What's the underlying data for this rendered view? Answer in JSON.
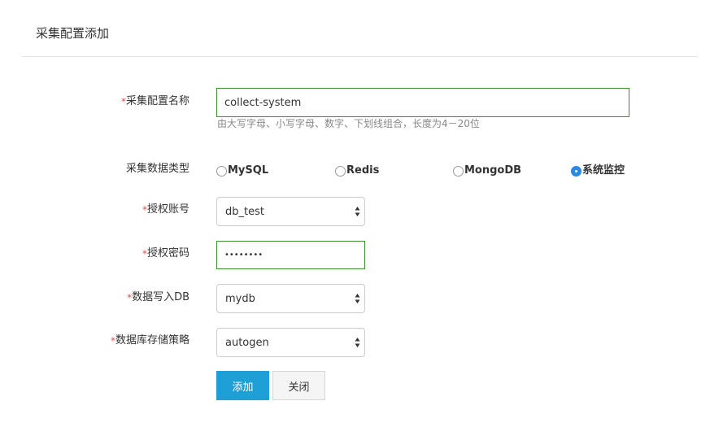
{
  "page": {
    "title": "采集配置添加"
  },
  "form": {
    "required_mark": "*",
    "config_name": {
      "label": "采集配置名称",
      "value": "collect-system",
      "hint": "由大写字母、小写字母、数字、下划线组合，长度为4－20位"
    },
    "data_type": {
      "label": "采集数据类型",
      "options": [
        "MySQL",
        "Redis",
        "MongoDB",
        "系统监控"
      ],
      "selected": "系统监控"
    },
    "auth_account": {
      "label": "授权账号",
      "value": "db_test"
    },
    "auth_password": {
      "label": "授权密码",
      "value": "••••••••"
    },
    "write_db": {
      "label": "数据写入DB",
      "value": "mydb"
    },
    "retention_policy": {
      "label": "数据库存储策略",
      "value": "autogen"
    }
  },
  "buttons": {
    "add_label": "添加",
    "close_label": "关闭"
  },
  "colors": {
    "accent_green_border": "#3b8e2f",
    "primary_button": "#1e9fd6",
    "required_star": "#d9534f",
    "radio_checked": "#2a8ae2"
  },
  "icons": {
    "select_arrow": "up-down-arrows-icon"
  }
}
